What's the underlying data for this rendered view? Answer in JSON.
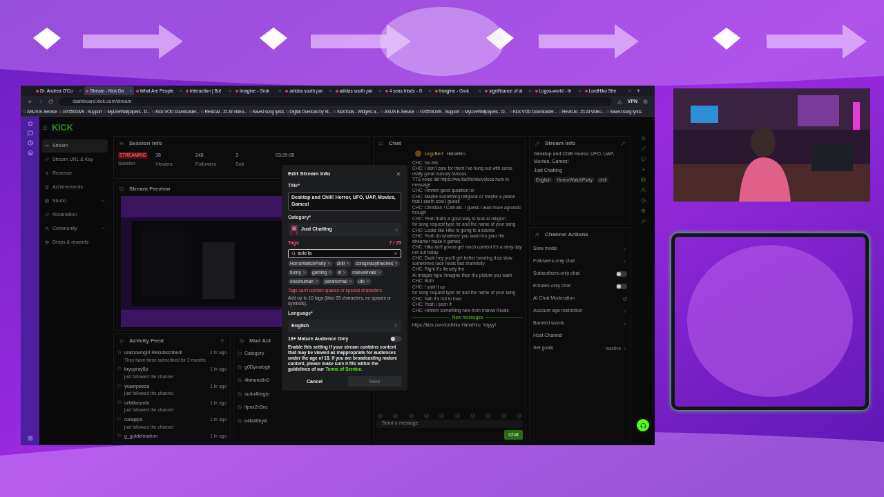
{
  "browser": {
    "tabs": [
      {
        "label": "Dr. Andrea O'Co",
        "selected": false
      },
      {
        "label": "Stream - Kick Da",
        "selected": true
      },
      {
        "label": "What Are People",
        "selected": false
      },
      {
        "label": "Interaction | Bot",
        "selected": false
      },
      {
        "label": "Imagine - Grok",
        "selected": false
      },
      {
        "label": "adidas south par",
        "selected": false
      },
      {
        "label": "adidas south par",
        "selected": false
      },
      {
        "label": "4 seas triads - G",
        "selected": false
      },
      {
        "label": "Imagine - Grok",
        "selected": false
      },
      {
        "label": "significance of al",
        "selected": false
      },
      {
        "label": "Logos-world - th",
        "selected": false
      },
      {
        "label": "LordHiko Stre",
        "selected": false
      }
    ],
    "address": "dashboard.kick.com/stream",
    "vpn": "VPN",
    "bookmarks": [
      "ASUS E-Service",
      "GX550LWS - Support",
      "MyLiveWallpapers - D...",
      "Kick VOD Downloader...",
      "Revid AI - #1 AI Video...",
      "Saved song lyrics",
      "Digital Overload by St...",
      "KickTools - Widgets a...",
      "ASUS E-Service",
      "GX550LWS - Support",
      "MyLiveWallpapers - D...",
      "Kick VOD Downloader...",
      "Revid AI - #1 AI Video...",
      "Saved song lyrics"
    ]
  },
  "sidebar": {
    "logo": "KICK",
    "items": [
      {
        "label": "Stream",
        "selected": true,
        "expandable": false
      },
      {
        "label": "Stream URL & Key",
        "selected": false,
        "expandable": false
      },
      {
        "label": "Revenue",
        "selected": false,
        "expandable": false
      },
      {
        "label": "Achievements",
        "selected": false,
        "expandable": false
      },
      {
        "label": "Studio",
        "selected": false,
        "expandable": true
      },
      {
        "label": "Moderation",
        "selected": false,
        "expandable": false
      },
      {
        "label": "Community",
        "selected": false,
        "expandable": true
      },
      {
        "label": "Drops & rewards",
        "selected": false,
        "expandable": false
      }
    ]
  },
  "session_info": {
    "title": "Session Info",
    "badge": "STREAMING",
    "badge_label": "Session",
    "stats": [
      {
        "value": "38",
        "label": "Viewers"
      },
      {
        "value": "248",
        "label": "Followers"
      },
      {
        "value": "3",
        "label": "Sub"
      },
      {
        "value": "03:29:08"
      }
    ]
  },
  "stream_preview": {
    "title": "Stream Preview"
  },
  "activity_feed": {
    "title": "Activity Feed",
    "items": [
      {
        "kind": "sub",
        "name": "unknowngirl Resubscribed!",
        "detail": "They have been subscribed for 2 months",
        "time": "1 hr ago"
      },
      {
        "kind": "follow",
        "name": "kryopray8p",
        "detail": "just followed the channel",
        "time": "1 hr ago"
      },
      {
        "kind": "follow",
        "name": "yvaerpeeza",
        "detail": "just followed the channel",
        "time": "1 hr ago"
      },
      {
        "kind": "follow",
        "name": "urfallveards",
        "detail": "just followed the channel",
        "time": "1 hr ago"
      },
      {
        "kind": "follow",
        "name": "rokajeps",
        "detail": "just followed the channel",
        "time": "1 hr ago"
      },
      {
        "kind": "follow",
        "name": "g_guldelmatron",
        "time": "1 hr ago"
      }
    ]
  },
  "mod_actions": {
    "title": "Mod Act",
    "items": [
      {
        "kind": "category",
        "name": "Category"
      },
      {
        "kind": "ban",
        "name": "g0Dynatogh"
      },
      {
        "kind": "ban",
        "name": "4bmenellx0"
      },
      {
        "kind": "ban",
        "name": "sudu4begio"
      },
      {
        "kind": "ban",
        "name": "ifpnx2n3nc"
      },
      {
        "kind": "ban",
        "name": "e4kbftlhyA"
      }
    ]
  },
  "chat": {
    "title": "Chat",
    "pinned": {
      "user": "LegoBert",
      "reply_to": "HahaHiro"
    },
    "messages": [
      "CHC: No lies",
      "CHC: I don't care for them I've hung out with some really great nobody famous",
      "TTS voice list https://ww.tts/lifehikovoices hum in message",
      "CHC: Hmmm good question lol",
      "CHC: Maybe something religious or maybe a peace that I seem cool I guess",
      "CHC: Christian / Catholic. I guess I lean more agnostic though",
      "CHC: Yeah that's a good way to look at religion",
      "for song request type !sr and the name of your song",
      "CHC: Looks like Hiko is going to a source",
      "CHC: Yeah do whatever you want bro your the streamer make it games",
      "CHC: Hiko isn't gonna get much content it's a rainy day not out today",
      "CHC: Dude hey you'll get better handing it as slow sometimes race heals fast thankfully",
      "CHC: Right it's literally fire",
      "AI Images type !imagine then the picture you want",
      "CHC: Both",
      "CHC: I said it up",
      "for song request type !sr and the name of your song",
      "CHC: Nah it's hot to bust",
      "CHC: Yeah I seen it",
      "CHC: Hmmm something new from marvel Rivals"
    ],
    "divider": "New messages",
    "last": "https://kick.com/lordhiko HahaHiro: Yayyy!",
    "placeholder": "Send a message",
    "send": "Chat"
  },
  "stream_info": {
    "title": "Stream info",
    "text": "Desktop and Chill! Horror, UFO, UAP, Movies, Games!",
    "category": "Just Chatting",
    "tags": [
      "English",
      "HorrorWatchParty",
      "chill"
    ]
  },
  "channel_actions": {
    "title": "Channel Actions",
    "items": [
      {
        "label": "Slow mode",
        "kind": "arrow"
      },
      {
        "label": "Followers-only chat",
        "kind": "arrow"
      },
      {
        "label": "Subscribers-only chat",
        "kind": "toggle",
        "on": false
      },
      {
        "label": "Emotes-only chat",
        "kind": "toggle",
        "on": false
      },
      {
        "label": "AI Chat Moderation",
        "kind": "external"
      },
      {
        "label": "Account age restriction",
        "kind": "arrow"
      },
      {
        "label": "Banned words",
        "kind": "arrow"
      },
      {
        "label": "Host Channel",
        "kind": "plain"
      },
      {
        "label": "Set goals",
        "kind": "arrow",
        "status": "Inactive"
      }
    ]
  },
  "modal": {
    "title": "Edit Stream Info",
    "title_label": "Title*",
    "title_value": "Desktop and Chill! Horror, UFO, UAP, Movies, Games!",
    "category_label": "Category*",
    "category": "Just Chatting",
    "tags_label": "Tags",
    "tags_count": "7 / 25",
    "tag_input": "solo la",
    "tags": [
      "HorrorWatchParty",
      "chill",
      "conspiracytheories",
      "funny",
      "gaming",
      "irl",
      "marvelrivals",
      "oncehuman",
      "paranormal",
      "ufo"
    ],
    "error": "Tags can't contain spaces or special characters.",
    "help": "Add up to 10 tags (Max 25 characters, no spaces or symbols).",
    "language_label": "Language*",
    "language": "English",
    "mature_label": "18+ Mature Audience Only",
    "mature_on": false,
    "mature_text": "Enable this setting if your stream contains content that may be viewed as inappropriate for audiences under the age of 18. If you are broadcasting mature content, please make sure it fits within the guidelines of our",
    "mature_link": "Terms of Service.",
    "cancel": "Cancel",
    "save": "Save",
    "save_disabled": true
  }
}
